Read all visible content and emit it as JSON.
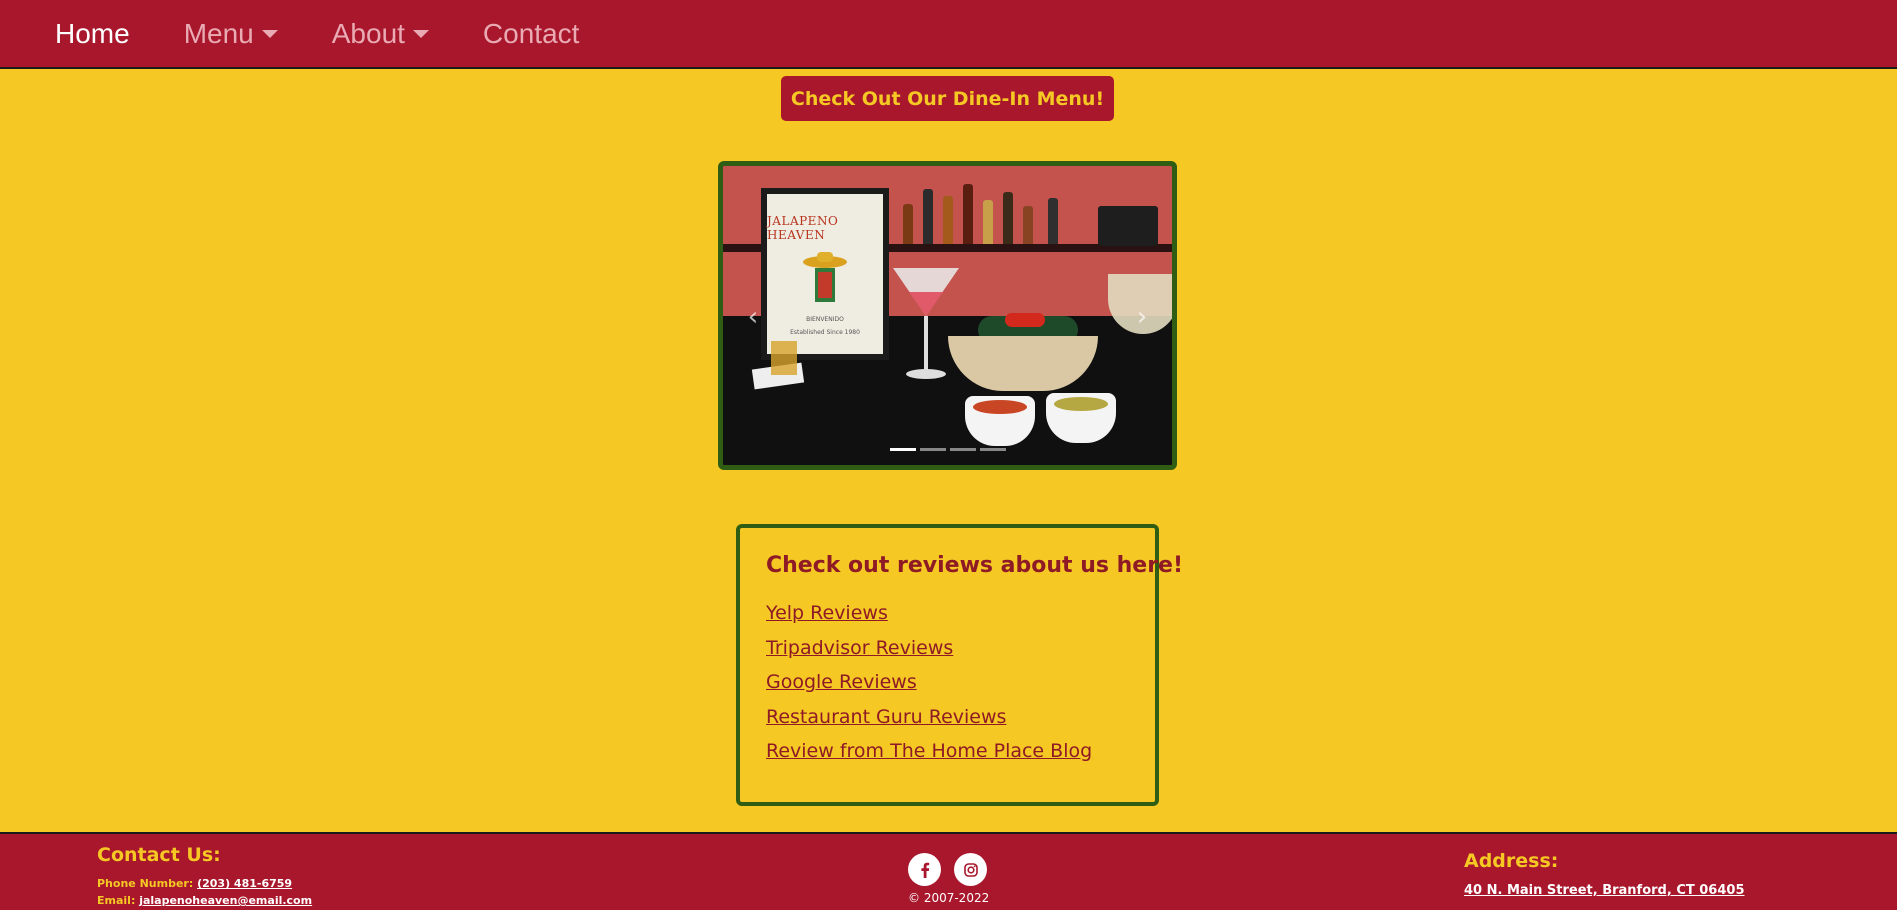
{
  "nav": {
    "items": [
      {
        "label": "Home",
        "active": true,
        "dropdown": false
      },
      {
        "label": "Menu",
        "active": false,
        "dropdown": true
      },
      {
        "label": "About",
        "active": false,
        "dropdown": true
      },
      {
        "label": "Contact",
        "active": false,
        "dropdown": false
      }
    ]
  },
  "dinein_button": {
    "label": "Check Out Our Dine-In Menu!"
  },
  "carousel": {
    "image_text": {
      "title": "JALAPENO HEAVEN",
      "subtitle": "BIENVENIDO",
      "established": "Established Since 1980"
    },
    "prev_icon": "chevron-left-icon",
    "next_icon": "chevron-right-icon",
    "slide_count": 4,
    "active_slide": 1
  },
  "reviews": {
    "title": "Check out reviews about us here!",
    "links": [
      "Yelp Reviews",
      "Tripadvisor Reviews",
      "Google Reviews",
      "Restaurant Guru Reviews",
      "Review from The Home Place Blog"
    ]
  },
  "footer": {
    "contact_title": "Contact Us:",
    "phone_label": "Phone Number:",
    "phone_value": "(203) 481-6759",
    "email_label": "Email:",
    "email_value": "jalapenoheaven@email.com",
    "socials": [
      "facebook-icon",
      "instagram-icon"
    ],
    "copyright": "© 2007-2022",
    "address_title": "Address:",
    "address_value": "40 N. Main Street, Branford, CT 06405"
  },
  "colors": {
    "brand_red": "#a8172c",
    "brand_yellow": "#f5c823",
    "border_green": "#2f5d14",
    "link_red": "#8e1a26"
  }
}
